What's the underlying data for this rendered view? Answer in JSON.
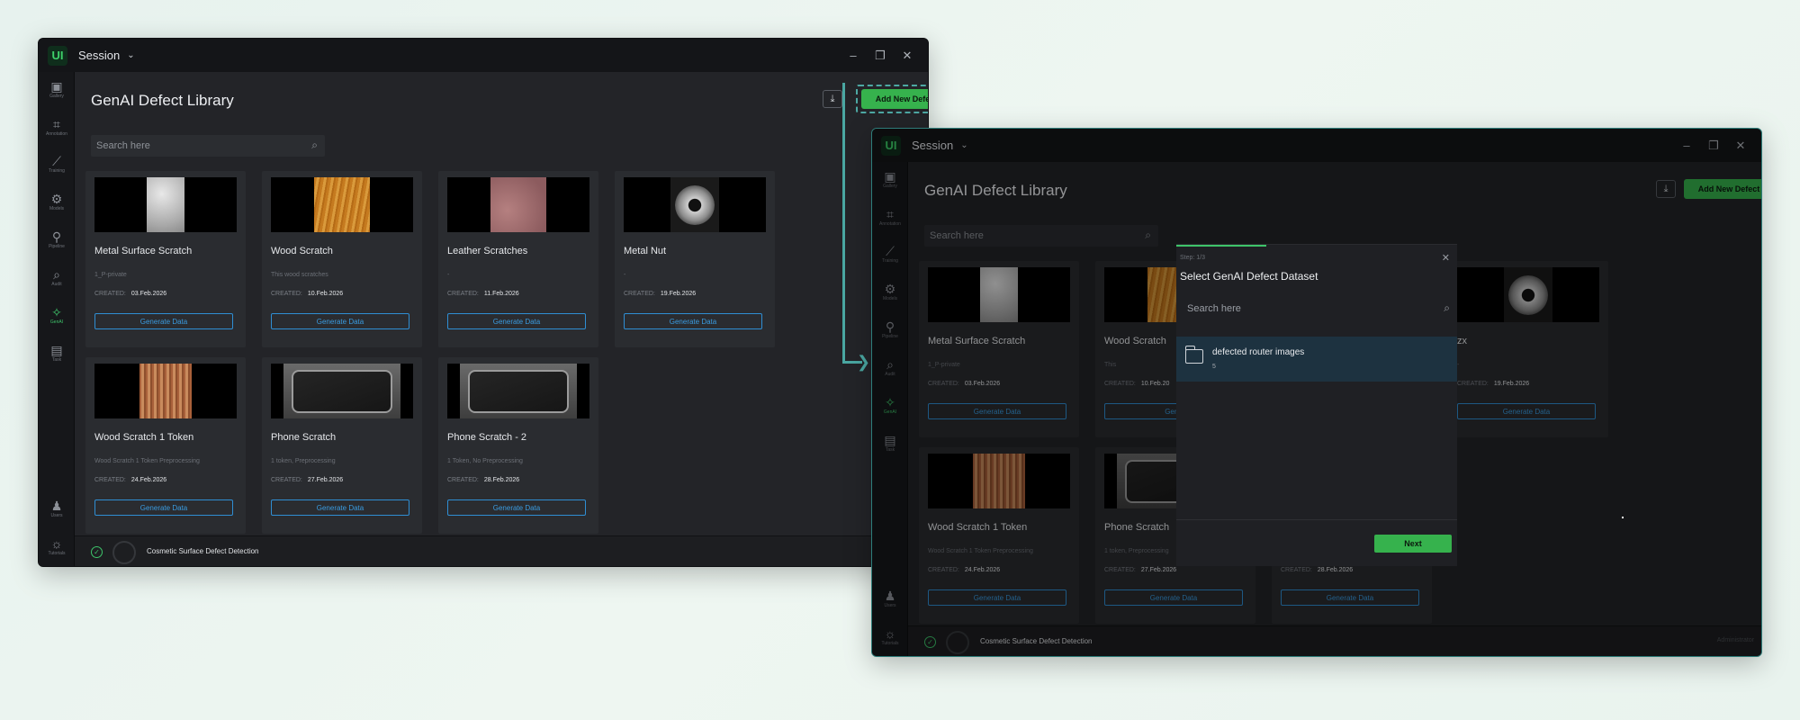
{
  "app": {
    "logo": "UI",
    "session_label": "Session",
    "window_controls": [
      "–",
      "❐",
      "✕"
    ]
  },
  "sidebar": {
    "items": [
      {
        "label": "Gallery",
        "icon": "gallery-icon",
        "glyph": "▣"
      },
      {
        "label": "Annotation",
        "icon": "crop-icon",
        "glyph": "⌗"
      },
      {
        "label": "Training",
        "icon": "chart-line-icon",
        "glyph": "⟋"
      },
      {
        "label": "Models",
        "icon": "gear-icon",
        "glyph": "⚙"
      },
      {
        "label": "Pipeline",
        "icon": "pipeline-icon",
        "glyph": "⚲"
      },
      {
        "label": "Audit",
        "icon": "magnify-icon",
        "glyph": "⌕"
      },
      {
        "label": "GenAI",
        "icon": "magic-wand-icon",
        "glyph": "✧",
        "active": true
      },
      {
        "label": "Task",
        "icon": "clipboard-icon",
        "glyph": "▤"
      }
    ],
    "bottom_items": [
      {
        "label": "Users",
        "icon": "user-icon",
        "glyph": "♟"
      },
      {
        "label": "Tutorials",
        "icon": "lightbulb-icon",
        "glyph": "☼"
      }
    ]
  },
  "page": {
    "title": "GenAI Defect Library",
    "add_button": "Add New Defect",
    "download_icon": "download-icon",
    "search_placeholder": "Search here"
  },
  "cards": [
    {
      "name": "Metal Surface Scratch",
      "desc": "1_P-private",
      "created_label": "CREATED:",
      "created": "03.Feb.2026",
      "button": "Generate Data",
      "thumb": "metal"
    },
    {
      "name": "Wood Scratch",
      "desc": "This wood scratches",
      "created_label": "CREATED:",
      "created": "10.Feb.2026",
      "button": "Generate Data",
      "thumb": "wood"
    },
    {
      "name": "Leather Scratches",
      "desc": "-",
      "created_label": "CREATED:",
      "created": "11.Feb.2026",
      "button": "Generate Data",
      "thumb": "leather"
    },
    {
      "name": "Metal Nut",
      "desc": "-",
      "created_label": "CREATED:",
      "created": "19.Feb.2026",
      "button": "Generate Data",
      "thumb": "nut"
    },
    {
      "name": "Wood Scratch 1 Token",
      "desc": "Wood Scratch 1 Token Preprocessing",
      "created_label": "CREATED:",
      "created": "24.Feb.2026",
      "button": "Generate Data",
      "thumb": "wood2"
    },
    {
      "name": "Phone Scratch",
      "desc": "1 token, Preprocessing",
      "created_label": "CREATED:",
      "created": "27.Feb.2026",
      "button": "Generate Data",
      "thumb": "phone"
    },
    {
      "name": "Phone Scratch - 2",
      "desc": "1 Token, No Preprocessing",
      "created_label": "CREATED:",
      "created": "28.Feb.2026",
      "button": "Generate Data",
      "thumb": "phone"
    }
  ],
  "cards_second": [
    {
      "name": "Metal Surface Scratch",
      "desc": "1_P-private",
      "created_label": "CREATED:",
      "created": "03.Feb.2026",
      "button": "Generate Data",
      "thumb": "metal"
    },
    {
      "name": "Wood Scratch",
      "desc": "This",
      "created_label": "CREATED:",
      "created": "10.Feb.20",
      "button": "Gene",
      "thumb": "wood"
    },
    {
      "name": "",
      "desc": "",
      "created_label": "",
      "created": "",
      "button": "",
      "thumb": "none"
    },
    {
      "name": "zx",
      "desc": "-",
      "created_label": "CREATED:",
      "created": "19.Feb.2026",
      "button": "Generate Data",
      "thumb": "nut"
    },
    {
      "name": "Wood Scratch 1 Token",
      "desc": "Wood Scratch 1 Token Preprocessing",
      "created_label": "CREATED:",
      "created": "24.Feb.2026",
      "button": "Generate Data",
      "thumb": "wood2"
    },
    {
      "name": "Phone Scratch",
      "desc": "1 token, Preprocessing",
      "created_label": "CREATED:",
      "created": "27.Feb.2026",
      "button": "Generate Data",
      "thumb": "phone"
    },
    {
      "name": "",
      "desc": "",
      "created_label": "CREATED:",
      "created": "28.Feb.2026",
      "button": "Generate Data",
      "thumb": "none"
    }
  ],
  "statusbar": {
    "project": "Cosmetic Surface Defect Detection",
    "user": "Administrator"
  },
  "modal": {
    "step": "Step: 1/3",
    "title": "Select GenAI Defect Dataset",
    "search_placeholder": "Search here",
    "dataset_name": "defected router images",
    "dataset_count": "5",
    "next_button": "Next",
    "close": "✕"
  },
  "colors": {
    "accent_green": "#36b24d",
    "link_blue": "#2f8ed3",
    "connector_teal": "#4aa7a2"
  }
}
